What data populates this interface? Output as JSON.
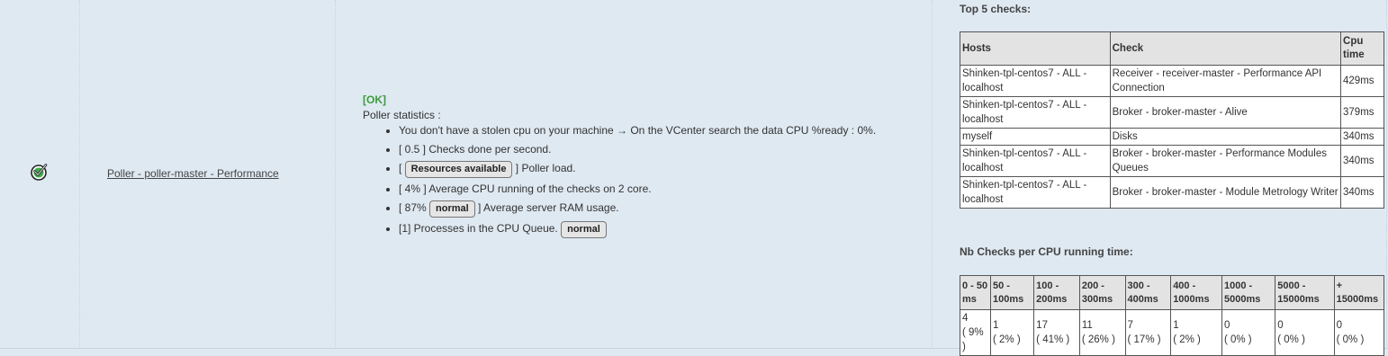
{
  "row": {
    "check_name": "Poller - poller-master - Performance",
    "status_icon": "ok-check-circle-icon",
    "colors": {
      "ok": "#3a9d3a",
      "background": "#dfe9f2"
    }
  },
  "output": {
    "status": "[OK]",
    "heading": "Poller statistics :",
    "lines": [
      {
        "pre": "You don't have a stolen cpu on your machine → On the VCenter search the data CPU %ready :  0%.",
        "badge": "",
        "post": ""
      },
      {
        "pre": "[ 0.5 ] Checks done per second.",
        "badge": "",
        "post": ""
      },
      {
        "pre": "[ ",
        "badge": "Resources available",
        "post": " ] Poller load."
      },
      {
        "pre": "[ 4% ] Average CPU running of the checks on 2 core.",
        "badge": "",
        "post": ""
      },
      {
        "pre": "[ 87% ",
        "badge": "normal",
        "post": " ] Average server RAM usage."
      },
      {
        "pre": "[1] Processes in the CPU Queue. ",
        "badge": "normal",
        "post": ""
      }
    ]
  },
  "top5": {
    "title": "Top 5 checks:",
    "headers": [
      "Hosts",
      "Check",
      "Cpu time"
    ],
    "rows": [
      [
        "Shinken-tpl-centos7 - ALL - localhost",
        "Receiver - receiver-master - Performance API Connection",
        "429ms"
      ],
      [
        "Shinken-tpl-centos7 - ALL - localhost",
        "Broker - broker-master - Alive",
        "379ms"
      ],
      [
        "myself",
        "Disks",
        "340ms"
      ],
      [
        "Shinken-tpl-centos7 - ALL - localhost",
        "Broker - broker-master - Performance Modules Queues",
        "340ms"
      ],
      [
        "Shinken-tpl-centos7 - ALL - localhost",
        "Broker - broker-master - Module Metrology Writer",
        "340ms"
      ]
    ]
  },
  "nb_checks": {
    "title": "Nb Checks per CPU running time:",
    "headers": [
      "0 - 50 ms",
      "50 - 100ms",
      "100 - 200ms",
      "200 - 300ms",
      "300 - 400ms",
      "400 - 1000ms",
      "1000 - 5000ms",
      "5000 - 15000ms",
      "+ 15000ms"
    ],
    "counts": [
      "4",
      "1",
      "17",
      "11",
      "7",
      "1",
      "0",
      "0",
      "0"
    ],
    "percents": [
      "( 9% )",
      "( 2% )",
      "( 41% )",
      "( 26% )",
      "( 17% )",
      "( 2% )",
      "( 0% )",
      "( 0% )",
      "( 0% )"
    ]
  }
}
